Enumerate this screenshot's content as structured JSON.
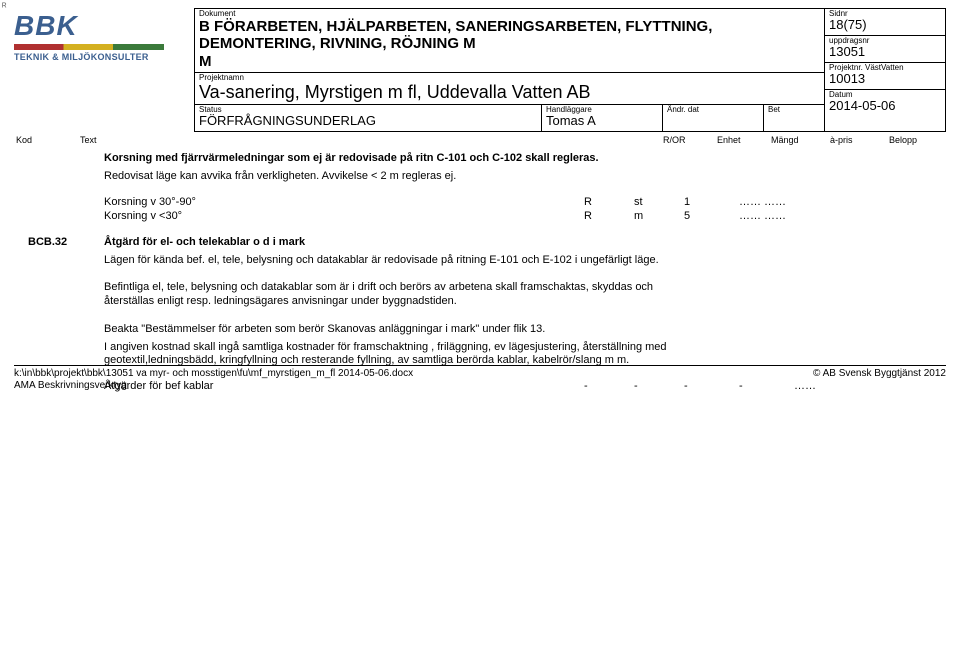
{
  "header": {
    "dokument_label": "Dokument",
    "dokument_value_line1": "B   FÖRARBETEN, HJÄLPARBETEN, SANERINGSARBETEN, FLYTTNING, DEMONTERING, RIVNING, RÖJNING M",
    "dokument_value_line2": "M",
    "projektnamn_label": "Projektnamn",
    "projektnamn_value": "Va-sanering, Myrstigen m fl, Uddevalla Vatten AB",
    "status_label": "Status",
    "status_value": "FÖRFRÅGNINGSUNDERLAG",
    "handlaggare_label": "Handläggare",
    "handlaggare_value": "Tomas A",
    "andr_label": "Ändr. dat",
    "andr_value": "",
    "bet_label": "Bet",
    "bet_value": "",
    "sidnr_label": "Sidnr",
    "sidnr_value": "18(75)",
    "uppdragsnr_label": "uppdragsnr",
    "uppdragsnr_value": "13051",
    "projektnr_label": "Projektnr. VästVatten",
    "projektnr_value": "10013",
    "datum_label": "Datum",
    "datum_value": "2014-05-06"
  },
  "logo": {
    "name": "BBK",
    "sub": "TEKNIK & MILJÖKONSULTER"
  },
  "colheaders": {
    "kod": "Kod",
    "text": "Text",
    "ror": "R/OR",
    "enhet": "Enhet",
    "mangd": "Mängd",
    "apris": "à-pris",
    "belopp": "Belopp"
  },
  "intro": {
    "p1": "Korsning med fjärrvärmeledningar som ej är redovisade på ritn C-101 och C-102 skall regleras.",
    "p2": "Redovisat läge kan avvika från verkligheten. Avvikelse < 2 m regleras ej."
  },
  "rows": [
    {
      "text": "Korsning v 30°-90°",
      "ror": "R",
      "enhet": "st",
      "mangd": "1",
      "apris": "",
      "belopp": ""
    },
    {
      "text": "Korsning v <30°",
      "ror": "R",
      "enhet": "m",
      "mangd": "5",
      "apris": "",
      "belopp": ""
    }
  ],
  "section_bcb32": {
    "kod": "BCB.32",
    "title": "Åtgärd för el- och telekablar o d i mark",
    "p1": "Lägen för kända bef. el, tele, belysning och datakablar är redovisade på ritning  E-101 och E-102 i ungefärligt läge.",
    "p2": "Befintliga el, tele, belysning och datakablar som är i drift och berörs av arbetena skall framschaktas, skyddas och återställas enligt resp. ledningsägares anvisningar under byggnadstiden.",
    "p3": "Beakta \"Bestämmelser för arbeten som berör Skanovas anläggningar i mark\" under flik 13.",
    "p4": "I angiven kostnad skall ingå samtliga kostnader för framschaktning , friläggning, ev lägesjustering, återställning med geotextil,ledningsbädd, kringfyllning och resterande fyllning, av samtliga berörda kablar, kabelrör/slang m m.",
    "row": {
      "text": "Åtgärder för bef kablar",
      "ror": "-",
      "enhet": "-",
      "mangd": "-",
      "apris": "-",
      "belopp": ""
    }
  },
  "footer": {
    "path": "k:\\in\\bbk\\projekt\\bbk\\13051 va myr- och mosstigen\\fu\\mf_myrstigen_m_fl 2014-05-06.docx",
    "tool": "AMA Beskrivningsverktyg",
    "copyright": "© AB Svensk Byggtjänst 2012"
  }
}
